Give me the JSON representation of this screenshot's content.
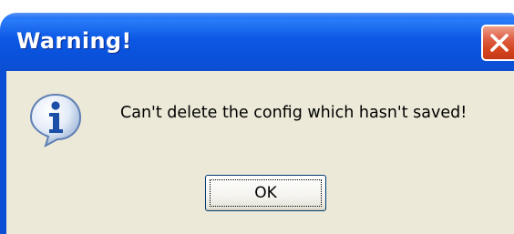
{
  "window": {
    "title": "Warning!",
    "close_icon": "close-icon",
    "titlebar_color": "#0c58e4",
    "close_button_color": "#d4441e",
    "body_color": "#ece9d8"
  },
  "dialog": {
    "icon": "info-icon",
    "message": "Can't delete the config which hasn't saved!",
    "ok_label": "OK"
  }
}
